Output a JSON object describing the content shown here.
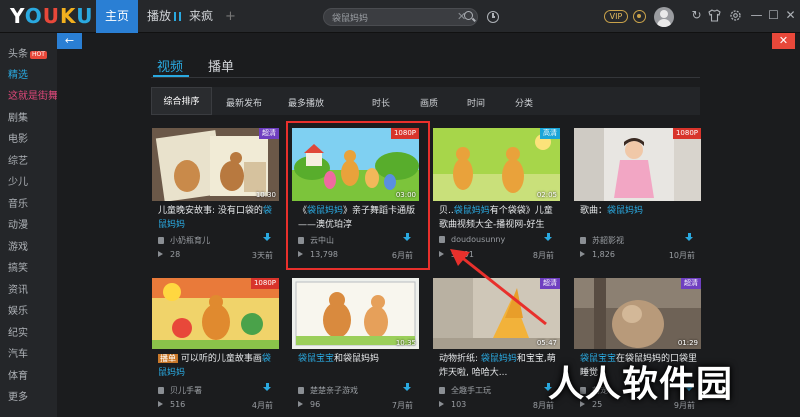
{
  "app": {
    "logo": "YOUKU"
  },
  "nav": {
    "home": "主页",
    "play": "播放",
    "fun": "来疯",
    "add": "+"
  },
  "search": {
    "value": "袋鼠妈妈",
    "clear": "✕"
  },
  "top_right": {
    "vip": "VIP",
    "minimize": "—",
    "maximize": "☐",
    "close": "✕",
    "refresh": "↻"
  },
  "sidebar": {
    "items": [
      {
        "label": "头条",
        "badge": "HOT"
      },
      {
        "label": "精选"
      },
      {
        "label": "这就是街舞"
      },
      {
        "label": "剧集"
      },
      {
        "label": "电影"
      },
      {
        "label": "综艺"
      },
      {
        "label": "少儿"
      },
      {
        "label": "音乐"
      },
      {
        "label": "动漫"
      },
      {
        "label": "游戏"
      },
      {
        "label": "搞笑"
      },
      {
        "label": "资讯"
      },
      {
        "label": "娱乐"
      },
      {
        "label": "纪实"
      },
      {
        "label": "汽车"
      },
      {
        "label": "体育"
      },
      {
        "label": "更多"
      }
    ]
  },
  "panel": {
    "back": "←",
    "close": "✕"
  },
  "tabs": {
    "video": "视频",
    "playlist": "播单"
  },
  "filters": {
    "comprehensive": "综合排序",
    "latest": "最新发布",
    "most_played": "最多播放",
    "duration": "时长",
    "quality": "画质",
    "time": "时间",
    "category": "分类"
  },
  "cards": [
    {
      "quality": "超清",
      "duration": "10:30",
      "title_pre": "儿童晚安故事: 没有口袋的",
      "title_hl": "袋鼠妈妈",
      "title_post": "",
      "author": "小奶瓶育儿",
      "plays": "28",
      "time": "3天前"
    },
    {
      "quality": "1080P",
      "duration": "03:00",
      "title_pre": "《",
      "title_hl": "袋鼠妈妈",
      "title_post": "》亲子舞蹈卡通版——澳优珀淳",
      "author": "云中山",
      "plays": "13,798",
      "time": "6月前"
    },
    {
      "quality": "高清",
      "duration": "02:05",
      "title_pre": "贝..",
      "title_hl": "袋鼠妈妈",
      "title_post": "有个袋袋》儿童歌曲视频大全-播视网-好生",
      "author": "doudousunny",
      "plays": "5,091",
      "time": "8月前"
    },
    {
      "quality": "1080P",
      "duration": "",
      "title_pre": "歌曲：",
      "title_hl": "袋鼠妈妈",
      "title_post": "",
      "author": "苏韶影视",
      "plays": "1,826",
      "time": "10月前"
    },
    {
      "quality": "1080P",
      "duration": "",
      "tag": "播单",
      "title_pre": " 可以听的儿童故事画",
      "title_hl": "袋鼠妈妈",
      "title_post": "",
      "author": "贝儿手署",
      "plays": "516",
      "time": "4月前"
    },
    {
      "quality": "",
      "duration": "10:35",
      "title_pre": "",
      "title_hl": "袋鼠宝宝",
      "title_post": "和袋鼠妈妈",
      "author": "楚楚亲子游戏",
      "plays": "96",
      "time": "7月前"
    },
    {
      "quality": "超清",
      "duration": "05:47",
      "title_pre": "动物折纸: ",
      "title_hl": "袋鼠妈妈",
      "title_post": "和宝宝,萌炸天啦, 哈哈大...",
      "author": "全趣手工玩",
      "plays": "103",
      "time": "8月前"
    },
    {
      "quality": "超清",
      "duration": "01:29",
      "title_pre": "",
      "title_hl": "袋鼠宝宝",
      "title_post": "在袋鼠妈妈的口袋里睡觉",
      "author": "萌宠",
      "plays": "25",
      "time": "9月前"
    }
  ],
  "watermark": "人人软件园"
}
